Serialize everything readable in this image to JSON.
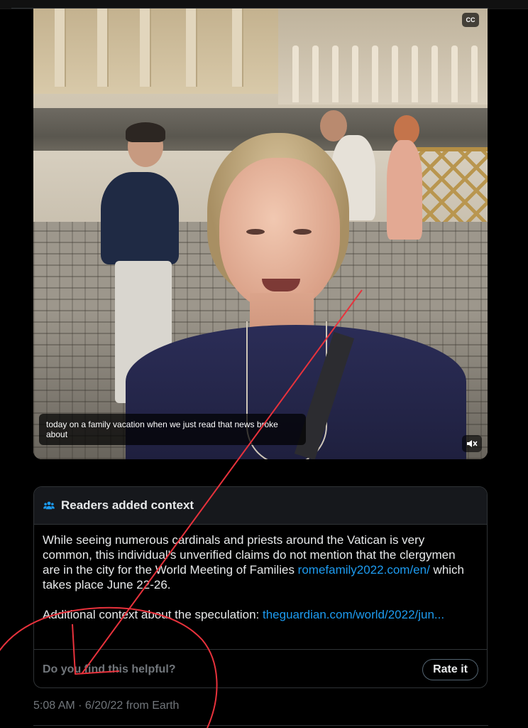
{
  "video": {
    "caption": "today on a family vacation when we just read that news broke about",
    "cc_label": "CC"
  },
  "context_card": {
    "title": "Readers added context",
    "body_lead": "While seeing numerous cardinals and priests around the Vatican is very common, this individual's unverified claims do not mention that the clergymen are in the city for the World Meeting of Families ",
    "link1": "romefamily2022.com/en/",
    "body_tail": "  which takes place June 22-26.",
    "body2_lead": "Additional context about the speculation: ",
    "link2": "theguardian.com/world/2022/jun...",
    "helpful_prompt": "Do you find this helpful?",
    "rate_button": "Rate it",
    "accent_color": "#1d9bf0"
  },
  "post": {
    "timestamp": "5:08 AM · 6/20/22 from Earth"
  },
  "annotation_color": "#e8323c"
}
